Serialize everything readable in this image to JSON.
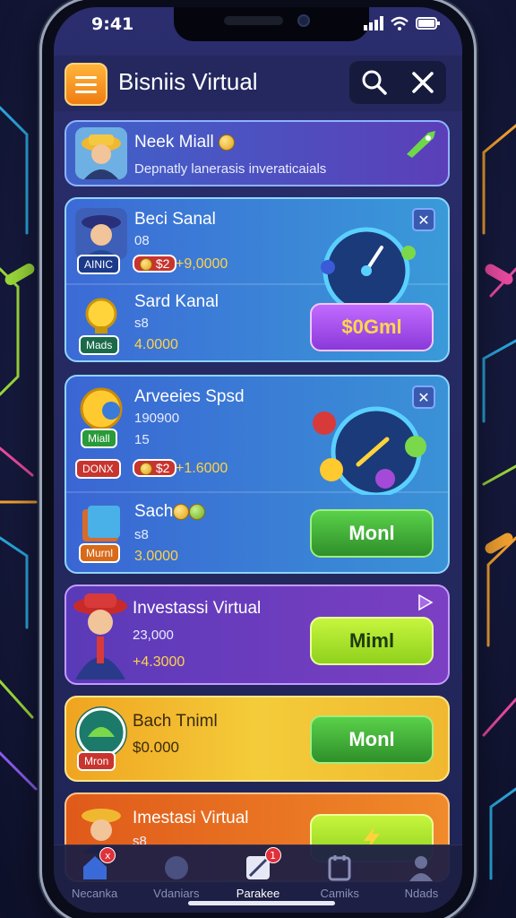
{
  "status": {
    "time": "9:41"
  },
  "header": {
    "title": "Bisniis Virtual"
  },
  "cards": [
    {
      "name": "Neek Miall",
      "subtitle": "Depnatly lanerasis inveraticaials"
    },
    {
      "top": {
        "name": "Beci Sanal",
        "line1": "08",
        "tag": "AINIC",
        "chip": "$2",
        "amount": "+9,0000"
      },
      "bottom": {
        "name": "Sard Kanal",
        "line1": "s8",
        "tag": "Mads",
        "amount": "4.0000"
      },
      "button": "$0Gml"
    },
    {
      "top": {
        "name": "Arveeies Spsd",
        "line1": "190900",
        "line2": "15",
        "tag": "Miall",
        "tag2": "DONX",
        "chip": "$2",
        "amount": "+1.6000"
      },
      "bottom": {
        "name": "Sach",
        "line1": "s8",
        "tag": "Murnl",
        "amount": "3.0000"
      },
      "button": "Monl"
    },
    {
      "name": "Investassi Virtual",
      "line1": "23,000",
      "amount": "+4.3000",
      "button": "Miml"
    },
    {
      "name": "Bach Tniml",
      "line1": "$0.000",
      "tag": "Mron",
      "button": "Monl"
    },
    {
      "name": "Imestasi Virtual",
      "line1": "s8"
    }
  ],
  "nav": [
    {
      "label": "Necanka",
      "badge": "x"
    },
    {
      "label": "Vdaniars"
    },
    {
      "label": "Parakee",
      "badge": "1"
    },
    {
      "label": "Camiks"
    },
    {
      "label": "Ndads"
    }
  ],
  "colors": {
    "accent": "#f07d12",
    "primary_bg": "#262a62",
    "green": "#2e8f2a",
    "purple": "#8a39d9",
    "gold": "#ffd24a"
  }
}
